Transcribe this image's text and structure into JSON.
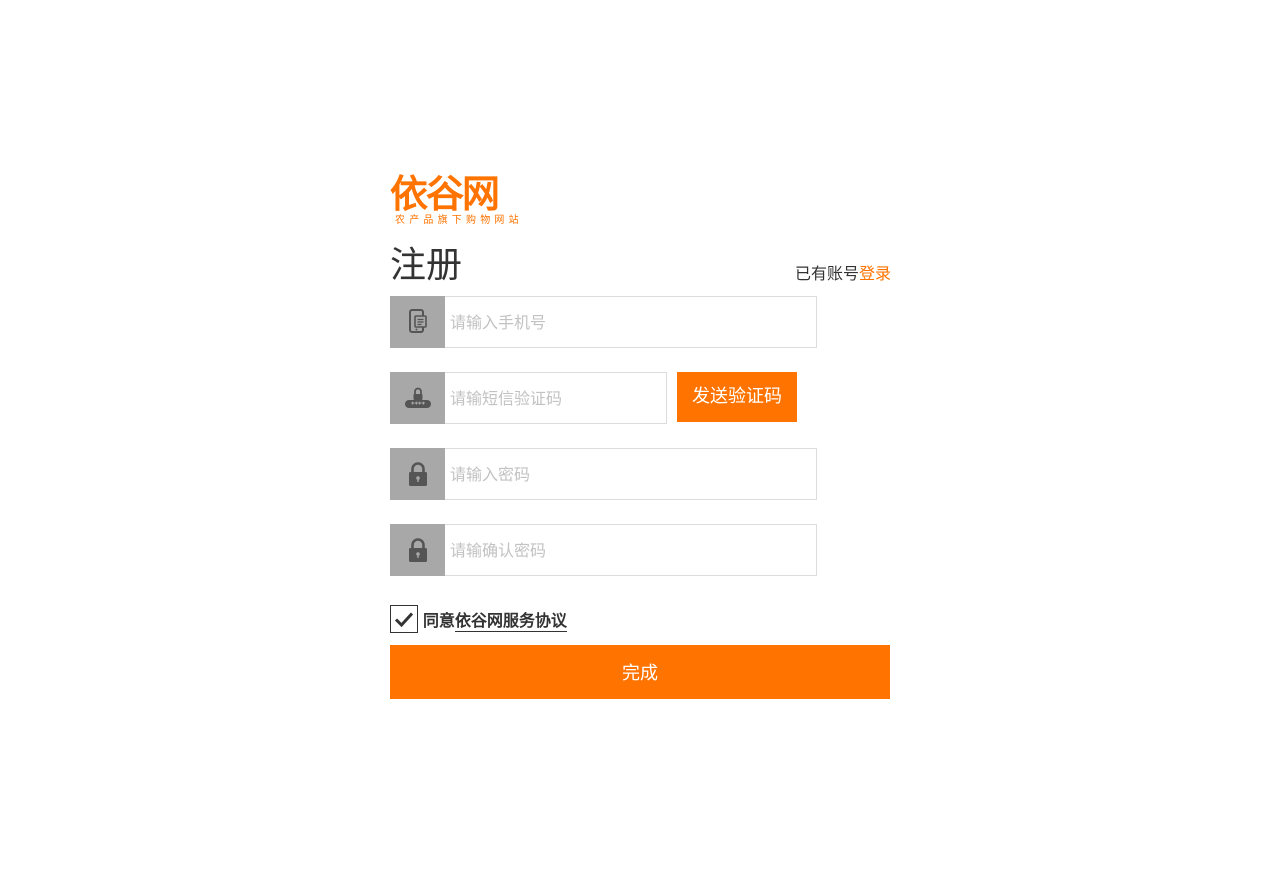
{
  "logo": {
    "name": "依谷网",
    "tagline": "农产品旗下购物网站"
  },
  "page_title": "注册",
  "login_hint": {
    "text": "已有账号",
    "link": "登录"
  },
  "form": {
    "phone": {
      "placeholder": "请输入手机号",
      "icon": "phone-icon"
    },
    "sms_code": {
      "placeholder": "请输短信验证码",
      "icon": "password-icon"
    },
    "send_code_label": "发送验证码",
    "password": {
      "placeholder": "请输入密码",
      "icon": "lock-icon"
    },
    "confirm_password": {
      "placeholder": "请输确认密码",
      "icon": "lock-icon"
    }
  },
  "agreement": {
    "prefix": "同意",
    "link": "依谷网服务协议",
    "checked": true
  },
  "submit_label": "完成",
  "colors": {
    "accent": "#ff7300",
    "icon_bg": "#a8a8a8",
    "border": "#dcdcdc"
  }
}
